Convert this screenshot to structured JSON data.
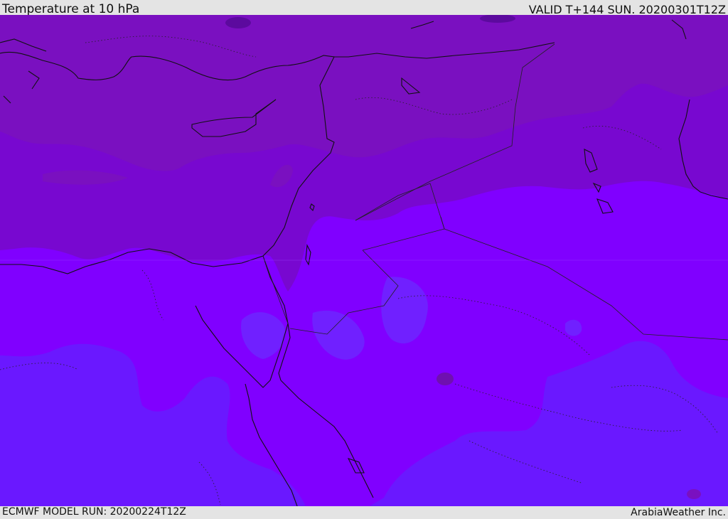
{
  "header": {
    "title": "Temperature at 10 hPa",
    "valid": "VALID T+144 SUN. 20200301T12Z"
  },
  "footer": {
    "model_run": "ECMWF MODEL RUN: 20200224T12Z",
    "credit": "ArabiaWeather Inc."
  },
  "map": {
    "field": "Temperature at 10 hPa",
    "region": "Eastern Mediterranean / Middle East",
    "colors": {
      "coldest": "#5c0a9e",
      "cold": "#7a10c0",
      "mid_cold": "#7808d0",
      "mid": "#8000ff",
      "warm": "#6a18ff",
      "coastline": "#111111",
      "border": "#222222"
    }
  }
}
